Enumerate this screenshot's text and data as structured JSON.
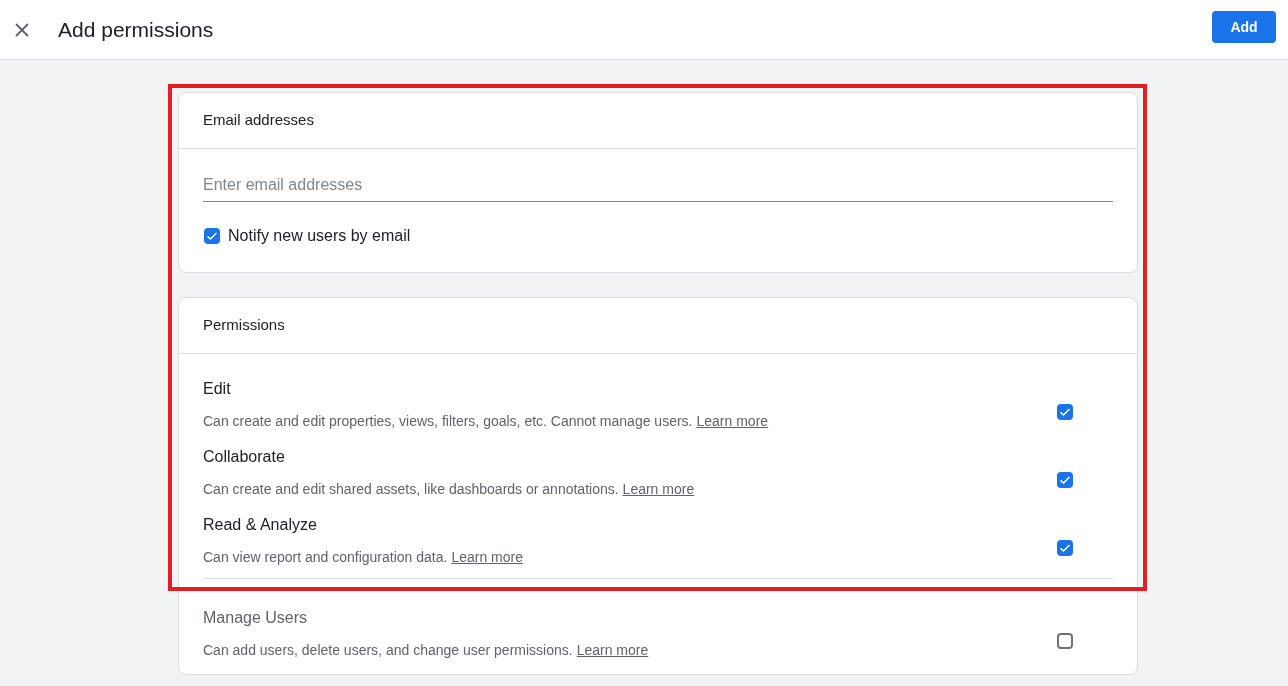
{
  "header": {
    "title": "Add permissions",
    "add_button": "Add"
  },
  "email_card": {
    "title": "Email addresses",
    "email_field": {
      "placeholder": "Enter email addresses"
    },
    "notify": {
      "label": "Notify new users by email",
      "checked": true
    }
  },
  "permissions_card": {
    "title": "Permissions",
    "items": [
      {
        "name": "Edit",
        "description": "Can create and edit properties, views, filters, goals, etc. Cannot manage users.",
        "link": "Learn more",
        "checked": true,
        "disabled": false
      },
      {
        "name": "Collaborate",
        "description": "Can create and edit shared assets, like dashboards or annotations.",
        "link": "Learn more",
        "checked": true,
        "disabled": false
      },
      {
        "name": "Read & Analyze",
        "description": "Can view report and configuration data.",
        "link": "Learn more",
        "checked": true,
        "disabled": false
      },
      {
        "name": "Manage Users",
        "description": "Can add users, delete users, and change user permissions.",
        "link": "Learn more",
        "checked": false,
        "disabled": true
      }
    ]
  }
}
